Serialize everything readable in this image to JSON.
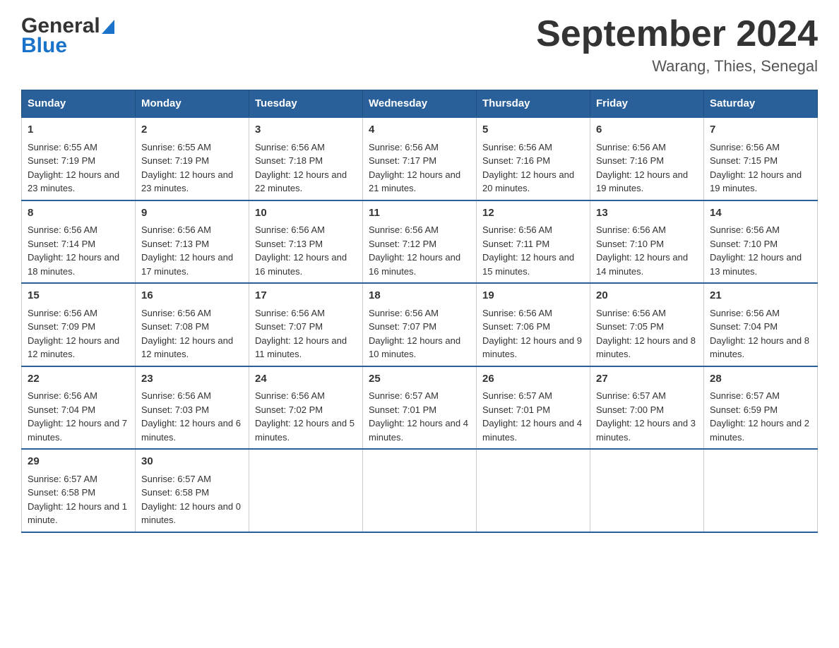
{
  "header": {
    "logo_general": "General",
    "logo_blue": "Blue",
    "main_title": "September 2024",
    "subtitle": "Warang, Thies, Senegal"
  },
  "calendar": {
    "days_of_week": [
      "Sunday",
      "Monday",
      "Tuesday",
      "Wednesday",
      "Thursday",
      "Friday",
      "Saturday"
    ],
    "weeks": [
      [
        {
          "day": "1",
          "sunrise": "Sunrise: 6:55 AM",
          "sunset": "Sunset: 7:19 PM",
          "daylight": "Daylight: 12 hours and 23 minutes."
        },
        {
          "day": "2",
          "sunrise": "Sunrise: 6:55 AM",
          "sunset": "Sunset: 7:19 PM",
          "daylight": "Daylight: 12 hours and 23 minutes."
        },
        {
          "day": "3",
          "sunrise": "Sunrise: 6:56 AM",
          "sunset": "Sunset: 7:18 PM",
          "daylight": "Daylight: 12 hours and 22 minutes."
        },
        {
          "day": "4",
          "sunrise": "Sunrise: 6:56 AM",
          "sunset": "Sunset: 7:17 PM",
          "daylight": "Daylight: 12 hours and 21 minutes."
        },
        {
          "day": "5",
          "sunrise": "Sunrise: 6:56 AM",
          "sunset": "Sunset: 7:16 PM",
          "daylight": "Daylight: 12 hours and 20 minutes."
        },
        {
          "day": "6",
          "sunrise": "Sunrise: 6:56 AM",
          "sunset": "Sunset: 7:16 PM",
          "daylight": "Daylight: 12 hours and 19 minutes."
        },
        {
          "day": "7",
          "sunrise": "Sunrise: 6:56 AM",
          "sunset": "Sunset: 7:15 PM",
          "daylight": "Daylight: 12 hours and 19 minutes."
        }
      ],
      [
        {
          "day": "8",
          "sunrise": "Sunrise: 6:56 AM",
          "sunset": "Sunset: 7:14 PM",
          "daylight": "Daylight: 12 hours and 18 minutes."
        },
        {
          "day": "9",
          "sunrise": "Sunrise: 6:56 AM",
          "sunset": "Sunset: 7:13 PM",
          "daylight": "Daylight: 12 hours and 17 minutes."
        },
        {
          "day": "10",
          "sunrise": "Sunrise: 6:56 AM",
          "sunset": "Sunset: 7:13 PM",
          "daylight": "Daylight: 12 hours and 16 minutes."
        },
        {
          "day": "11",
          "sunrise": "Sunrise: 6:56 AM",
          "sunset": "Sunset: 7:12 PM",
          "daylight": "Daylight: 12 hours and 16 minutes."
        },
        {
          "day": "12",
          "sunrise": "Sunrise: 6:56 AM",
          "sunset": "Sunset: 7:11 PM",
          "daylight": "Daylight: 12 hours and 15 minutes."
        },
        {
          "day": "13",
          "sunrise": "Sunrise: 6:56 AM",
          "sunset": "Sunset: 7:10 PM",
          "daylight": "Daylight: 12 hours and 14 minutes."
        },
        {
          "day": "14",
          "sunrise": "Sunrise: 6:56 AM",
          "sunset": "Sunset: 7:10 PM",
          "daylight": "Daylight: 12 hours and 13 minutes."
        }
      ],
      [
        {
          "day": "15",
          "sunrise": "Sunrise: 6:56 AM",
          "sunset": "Sunset: 7:09 PM",
          "daylight": "Daylight: 12 hours and 12 minutes."
        },
        {
          "day": "16",
          "sunrise": "Sunrise: 6:56 AM",
          "sunset": "Sunset: 7:08 PM",
          "daylight": "Daylight: 12 hours and 12 minutes."
        },
        {
          "day": "17",
          "sunrise": "Sunrise: 6:56 AM",
          "sunset": "Sunset: 7:07 PM",
          "daylight": "Daylight: 12 hours and 11 minutes."
        },
        {
          "day": "18",
          "sunrise": "Sunrise: 6:56 AM",
          "sunset": "Sunset: 7:07 PM",
          "daylight": "Daylight: 12 hours and 10 minutes."
        },
        {
          "day": "19",
          "sunrise": "Sunrise: 6:56 AM",
          "sunset": "Sunset: 7:06 PM",
          "daylight": "Daylight: 12 hours and 9 minutes."
        },
        {
          "day": "20",
          "sunrise": "Sunrise: 6:56 AM",
          "sunset": "Sunset: 7:05 PM",
          "daylight": "Daylight: 12 hours and 8 minutes."
        },
        {
          "day": "21",
          "sunrise": "Sunrise: 6:56 AM",
          "sunset": "Sunset: 7:04 PM",
          "daylight": "Daylight: 12 hours and 8 minutes."
        }
      ],
      [
        {
          "day": "22",
          "sunrise": "Sunrise: 6:56 AM",
          "sunset": "Sunset: 7:04 PM",
          "daylight": "Daylight: 12 hours and 7 minutes."
        },
        {
          "day": "23",
          "sunrise": "Sunrise: 6:56 AM",
          "sunset": "Sunset: 7:03 PM",
          "daylight": "Daylight: 12 hours and 6 minutes."
        },
        {
          "day": "24",
          "sunrise": "Sunrise: 6:56 AM",
          "sunset": "Sunset: 7:02 PM",
          "daylight": "Daylight: 12 hours and 5 minutes."
        },
        {
          "day": "25",
          "sunrise": "Sunrise: 6:57 AM",
          "sunset": "Sunset: 7:01 PM",
          "daylight": "Daylight: 12 hours and 4 minutes."
        },
        {
          "day": "26",
          "sunrise": "Sunrise: 6:57 AM",
          "sunset": "Sunset: 7:01 PM",
          "daylight": "Daylight: 12 hours and 4 minutes."
        },
        {
          "day": "27",
          "sunrise": "Sunrise: 6:57 AM",
          "sunset": "Sunset: 7:00 PM",
          "daylight": "Daylight: 12 hours and 3 minutes."
        },
        {
          "day": "28",
          "sunrise": "Sunrise: 6:57 AM",
          "sunset": "Sunset: 6:59 PM",
          "daylight": "Daylight: 12 hours and 2 minutes."
        }
      ],
      [
        {
          "day": "29",
          "sunrise": "Sunrise: 6:57 AM",
          "sunset": "Sunset: 6:58 PM",
          "daylight": "Daylight: 12 hours and 1 minute."
        },
        {
          "day": "30",
          "sunrise": "Sunrise: 6:57 AM",
          "sunset": "Sunset: 6:58 PM",
          "daylight": "Daylight: 12 hours and 0 minutes."
        },
        null,
        null,
        null,
        null,
        null
      ]
    ]
  }
}
